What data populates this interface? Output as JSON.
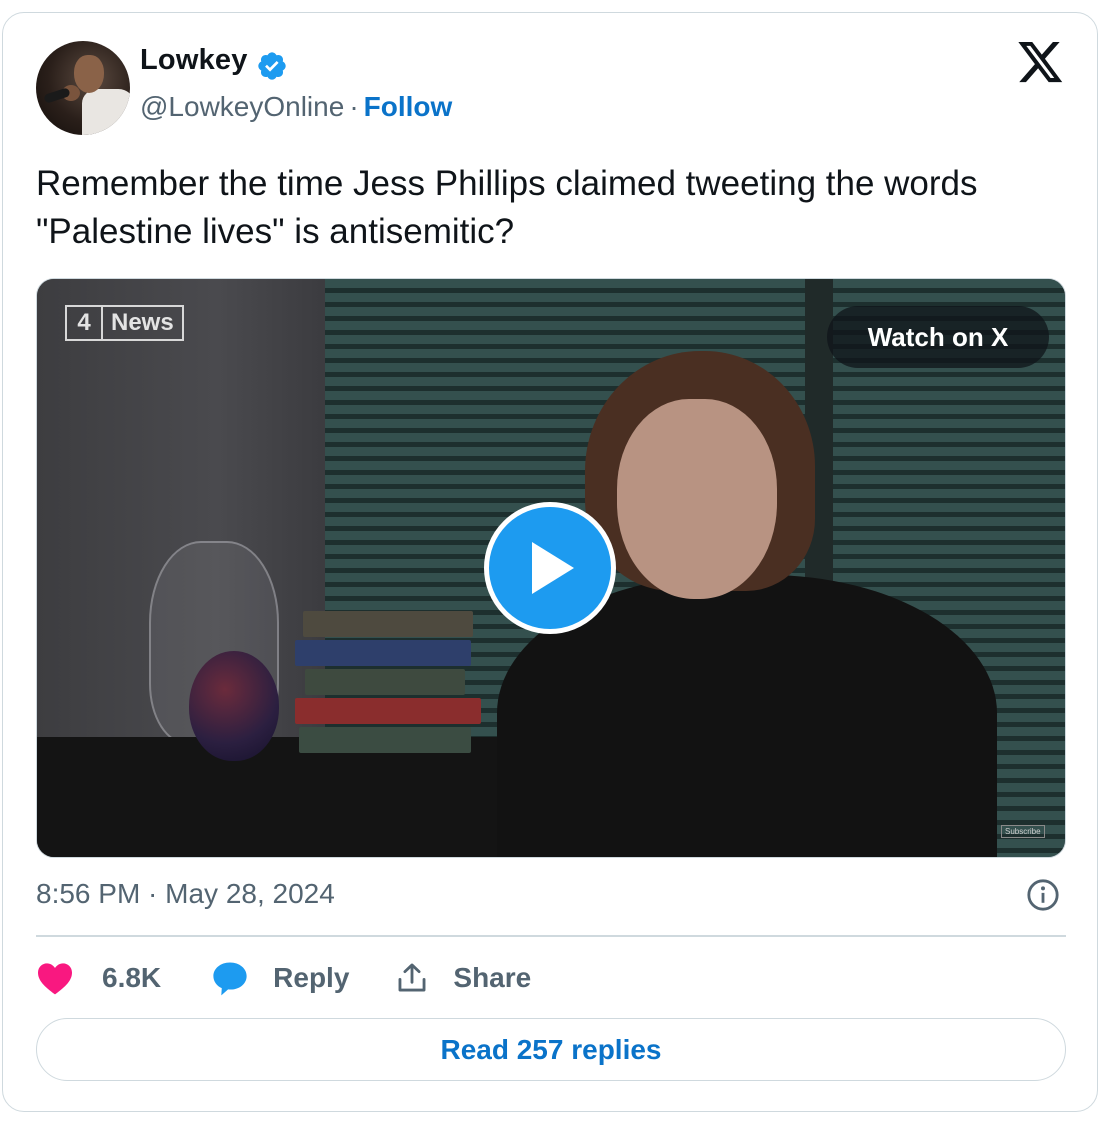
{
  "author": {
    "name": "Lowkey",
    "handle": "@LowkeyOnline",
    "separator": "·",
    "follow_label": "Follow",
    "verified_icon": "verified-badge-icon",
    "avatar": "avatar-image"
  },
  "platform_logo": "x-logo-icon",
  "tweet": {
    "text": "Remember the time Jess Phillips claimed tweeting the words \"Palestine lives\" is antisemitic?"
  },
  "video": {
    "channel_logo_number": "4",
    "channel_logo_text": "News",
    "watch_label": "Watch on X",
    "play_icon": "play-icon",
    "subscribe_label": "Subscribe"
  },
  "meta": {
    "timestamp": "8:56 PM · May 28, 2024",
    "info_icon": "info-icon"
  },
  "actions": {
    "likes_count": "6.8K",
    "reply_label": "Reply",
    "share_label": "Share"
  },
  "read_replies_label": "Read 257 replies",
  "colors": {
    "accent_blue": "#1d9bf0",
    "link_blue": "#0a73c9",
    "like_pink": "#f91880",
    "muted_text": "#536471",
    "border": "#cfd9de"
  }
}
